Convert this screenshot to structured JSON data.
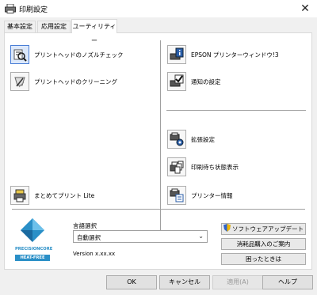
{
  "window": {
    "title": "印刷設定",
    "close_glyph": "✕"
  },
  "tabs": [
    {
      "label": "基本設定",
      "active": false
    },
    {
      "label": "応用設定",
      "active": false
    },
    {
      "label": "ユーティリティー",
      "active": true
    }
  ],
  "utilities": {
    "nozzle_check": "プリントヘッドのノズルチェック",
    "head_cleaning": "プリントヘッドのクリーニング",
    "print_lite": "まとめてプリント Lite",
    "status_monitor": "EPSON プリンターウィンドウ!3",
    "notification": "通知の設定",
    "extended": "拡張設定",
    "print_queue": "印刷待ち状態表示",
    "printer_info": "プリンター情報"
  },
  "logo": {
    "line1": "PRECISIONCORE",
    "line2": "HEAT-FREE"
  },
  "language": {
    "label": "言語選択",
    "selected": "自動選択"
  },
  "version": "Version x.xx.xx",
  "side_buttons": {
    "software_update": "ソフトウェアアップデート",
    "supplies": "消耗品購入のご案内",
    "help_trouble": "困ったときは"
  },
  "footer": {
    "ok": "OK",
    "cancel": "キャンセル",
    "apply": "適用(A)",
    "help": "ヘルプ"
  },
  "colors": {
    "accent": "#4a7ed6",
    "logo_blue": "#2a8fc7"
  }
}
